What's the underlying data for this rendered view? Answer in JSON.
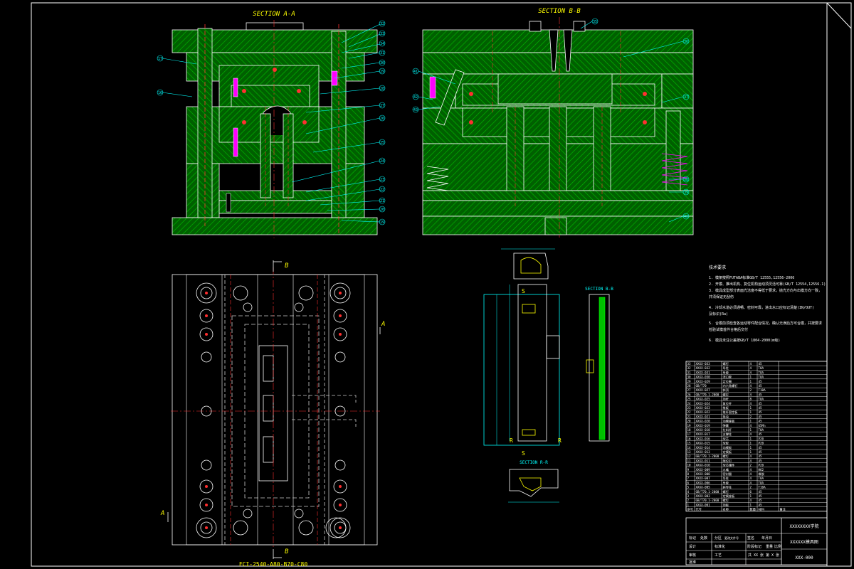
{
  "drawing": {
    "section_aa_title": "SECTION A-A",
    "section_bb_title": "SECTION B-B",
    "part_section_bb_title": "SECTION B-B",
    "part_section_rr_title": "SECTION R-R",
    "mold_base_spec": "FCI-2540-A80-B70-C80",
    "cut_letter_a": "A",
    "cut_letter_b": "B",
    "cut_letter_r": "R",
    "cut_letter_s": "S"
  },
  "balloons_aa": [
    "32",
    "33",
    "34",
    "31",
    "30",
    "29",
    "28",
    "27",
    "26",
    "25",
    "24",
    "23",
    "22",
    "21",
    "20",
    "19",
    "18"
  ],
  "balloons_aa_left": [
    "17",
    "16"
  ],
  "balloons_bb": [
    "35",
    "36",
    "37",
    "38",
    "39",
    "40",
    "41",
    "42",
    "43",
    "44"
  ],
  "notes": {
    "title": "技术要求",
    "lines": [
      "1. 模架按照FUTABA标准GB/T 12555,12556-2006",
      "2. 开模、推出机构、复位机构运动须灵活可靠(GB/T 12554,12556.1)",
      "3. 模具成型部分表面光洁度不得低于要求，抛光方向与出模方向一致，",
      "   并须保证无刮伤",
      "4. 冷却水道必须通畅、密封可靠，进出水口应标记清楚(IN/OUT)",
      "   及标识(Ra)",
      "5. 合模前须检查各运动零件配合情况，确认无误后方可合模，并按要求",
      "   检验试模首件合格后交付",
      "6. 模具未注公差按GB/T 1804-2000(m级)"
    ]
  },
  "bom": {
    "rows": [
      [
        "33",
        "XXXX-033",
        "螺钉",
        "4",
        "45",
        ""
      ],
      [
        "32",
        "XXXX-032",
        "导柱",
        "4",
        "T8A",
        ""
      ],
      [
        "31",
        "XXXX-031",
        "导套",
        "4",
        "T8A",
        ""
      ],
      [
        "30",
        "XXXX-030",
        "浇口套",
        "1",
        "T8A",
        ""
      ],
      [
        "29",
        "XXXX-029",
        "定位圈",
        "1",
        "45",
        ""
      ],
      [
        "28",
        "GB/T70",
        "内六角螺钉",
        "4",
        "45",
        ""
      ],
      [
        "27",
        "XXXX-027",
        "斜顶",
        "2",
        "T10A",
        ""
      ],
      [
        "26",
        "GB/T70.1-2000",
        "螺钉",
        "4",
        "45",
        ""
      ],
      [
        "25",
        "XXXX-025",
        "顶杆",
        "8",
        "T8A",
        ""
      ],
      [
        "24",
        "XXXX-024",
        "复位杆",
        "4",
        "45",
        ""
      ],
      [
        "23",
        "XXXX-023",
        "推板",
        "1",
        "45",
        ""
      ],
      [
        "22",
        "XXXX-022",
        "推杆固定板",
        "1",
        "45",
        ""
      ],
      [
        "21",
        "XXXX-021",
        "垫块",
        "2",
        "45",
        ""
      ],
      [
        "20",
        "XXXX-020",
        "动模座板",
        "1",
        "45",
        ""
      ],
      [
        "19",
        "XXXX-019",
        "弹簧",
        "4",
        "65Mn",
        ""
      ],
      [
        "18",
        "XXXX-018",
        "拉料杆",
        "1",
        "T8A",
        ""
      ],
      [
        "17",
        "XXXX-017",
        "支撑柱",
        "4",
        "45",
        ""
      ],
      [
        "16",
        "XXXX-016",
        "型芯",
        "1",
        "P20",
        ""
      ],
      [
        "15",
        "XXXX-015",
        "型腔",
        "1",
        "P20",
        ""
      ],
      [
        "14",
        "XXXX-014",
        "动模板",
        "1",
        "45",
        ""
      ],
      [
        "13",
        "XXXX-013",
        "定模板",
        "1",
        "45",
        ""
      ],
      [
        "12",
        "GB/T70.1-2000",
        "螺钉",
        "4",
        "45",
        ""
      ],
      [
        "11",
        "XXXX-011",
        "限位钉",
        "4",
        "45",
        ""
      ],
      [
        "10",
        "XXXX-010",
        "型芯镶件",
        "2",
        "P20",
        ""
      ],
      [
        "9",
        "XXXX-009",
        "水嘴",
        "4",
        "H62",
        ""
      ],
      [
        "8",
        "XXXX-008",
        "密封圈",
        "4",
        "橡胶",
        ""
      ],
      [
        "7",
        "XXXX-007",
        "导柱",
        "4",
        "T8A",
        ""
      ],
      [
        "6",
        "XXXX-006",
        "导套",
        "4",
        "T8A",
        ""
      ],
      [
        "5",
        "XXXX-005",
        "斜导柱",
        "2",
        "T10A",
        ""
      ],
      [
        "4",
        "GB/T70.1-2000",
        "螺钉",
        "6",
        "45",
        ""
      ],
      [
        "3",
        "XXXX-003",
        "定模座板",
        "1",
        "45",
        ""
      ],
      [
        "2",
        "GB/T70.1-2000",
        "螺钉",
        "4",
        "45",
        ""
      ],
      [
        "1",
        "XXXX-001",
        "顶板",
        "1",
        "45",
        ""
      ]
    ],
    "header": [
      "序号",
      "代号",
      "名称",
      "数量",
      "材料",
      "备注"
    ]
  },
  "title_block": {
    "company": "XXXXXXXX学院",
    "drawing_name": "XXXXXX模具图",
    "drawing_no": "XXX-000",
    "scale_text": "共 XX 张 第 X 张",
    "cells": [
      "标记",
      "处数",
      "分区",
      "更改文件号",
      "签名",
      "年月日",
      "设计",
      "标准化",
      "审核",
      "工艺",
      "批准",
      "阶段标记",
      "重量",
      "比例"
    ]
  },
  "colors": {
    "hatch": "#00a000",
    "frame": "#ffffff",
    "cyan": "#00ffff",
    "yellow": "#ffff00",
    "red": "#ff0000",
    "magenta": "#ff00ff"
  }
}
